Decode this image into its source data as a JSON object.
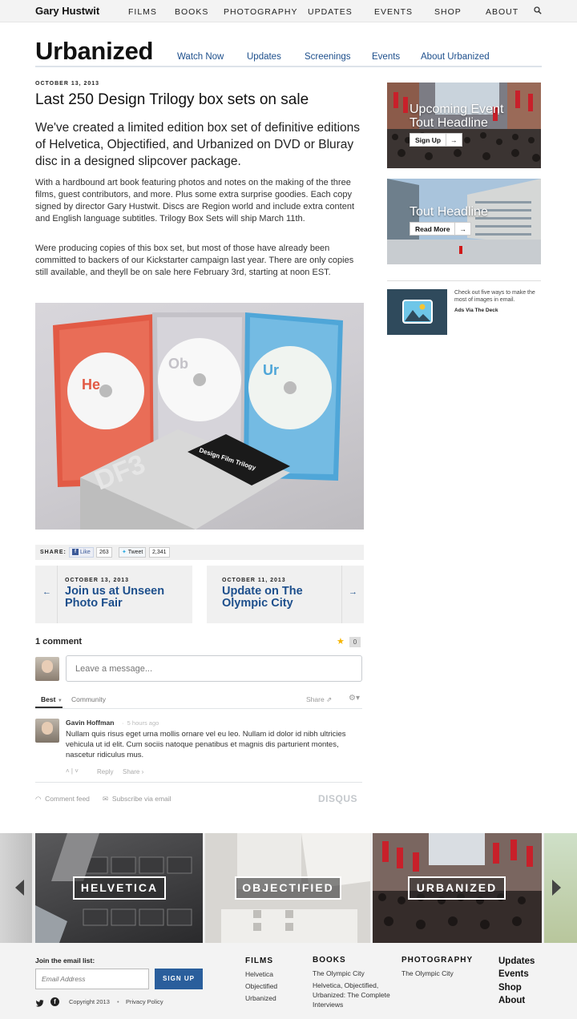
{
  "topnav": {
    "site_title": "Gary Hustwit",
    "items": [
      "FILMS",
      "BOOKS",
      "PHOTOGRAPHY",
      "UPDATES",
      "EVENTS",
      "SHOP",
      "ABOUT"
    ]
  },
  "film": {
    "title": "Urbanized",
    "subnav": [
      "Watch Now",
      "Updates",
      "Screenings",
      "Events",
      "About Urbanized"
    ]
  },
  "post": {
    "date": "OCTOBER 13, 2013",
    "title": "Last 250 Design Trilogy box sets on sale",
    "lead": "We've created a limited edition box set of definitive editions of Helvetica, Objectified, and Urbanized on DVD or Bluray disc in a designed slipcover package.",
    "para1": "With a hardbound art book featuring photos and notes on the making of the three films, guest contributors, and more. Plus some extra surprise goodies. Each copy signed by director Gary Hustwit. Discs are Region world and include extra content and English language subtitles. Trilogy Box Sets will ship March 11th.",
    "para2": "Were producing copies of this box set, but most of those have already been committed to backers of our Kickstarter campaign last year. There are only copies still available, and theyll be on sale here February 3rd, starting at noon EST.",
    "image": {
      "disc_labels": [
        "He",
        "Ob",
        "Ur"
      ],
      "box_label": "DF3",
      "card_text": "Design Film Trilogy"
    }
  },
  "share": {
    "label": "SHARE:",
    "like_label": "Like",
    "like_count": "263",
    "tweet_label": "Tweet",
    "tweet_count": "2,341"
  },
  "prev_post": {
    "date": "OCTOBER 13, 2013",
    "title": "Join us at Unseen Photo Fair",
    "arrow": "←"
  },
  "next_post": {
    "date": "OCTOBER 11, 2013",
    "title": "Update on The Olympic City",
    "arrow": "→"
  },
  "comments": {
    "count_label": "1 comment",
    "star_count": "0",
    "placeholder": "Leave a message...",
    "tab_best": "Best",
    "tab_community": "Community",
    "share_label": "Share",
    "comment": {
      "author": "Gavin Hoffman",
      "time": "5 hours ago",
      "text": "Nullam quis risus eget urna mollis ornare vel eu leo. Nullam id dolor id nibh ultricies vehicula ut id elit. Cum sociis natoque penatibus et magnis dis parturient montes, nascetur ridiculus mus.",
      "reply": "Reply",
      "share": "Share ›"
    },
    "comment_feed": "Comment feed",
    "subscribe": "Subscribe via email",
    "brand": "DISQUS"
  },
  "sidebar": {
    "tout1": {
      "headline_line1": "Upcoming Event",
      "headline_line2": "Tout Headline",
      "button": "Sign Up"
    },
    "tout2": {
      "headline": "Tout Headline",
      "button": "Read More"
    },
    "ad": {
      "text": "Check out five ways to make the most of images in email.",
      "via": "Ads Via The Deck"
    }
  },
  "featured": {
    "labels": [
      "HELVETICA",
      "OBJECTIFIED",
      "URBANIZED"
    ]
  },
  "footer": {
    "email_label": "Join the email list:",
    "email_placeholder": "Email Address",
    "signup": "SIGN UP",
    "copyright": "Copyright 2013",
    "privacy": "Privacy Policy",
    "films_heading": "FILMS",
    "films": [
      "Helvetica",
      "Objectified",
      "Urbanized"
    ],
    "books_heading": "BOOKS",
    "books": [
      "The Olympic City",
      "Helvetica, Objectified, Urbanized: The Complete Interviews"
    ],
    "photo_heading": "PHOTOGRAPHY",
    "photo": [
      "The Olympic City"
    ],
    "links": [
      "Updates",
      "Events",
      "Shop",
      "About"
    ]
  }
}
